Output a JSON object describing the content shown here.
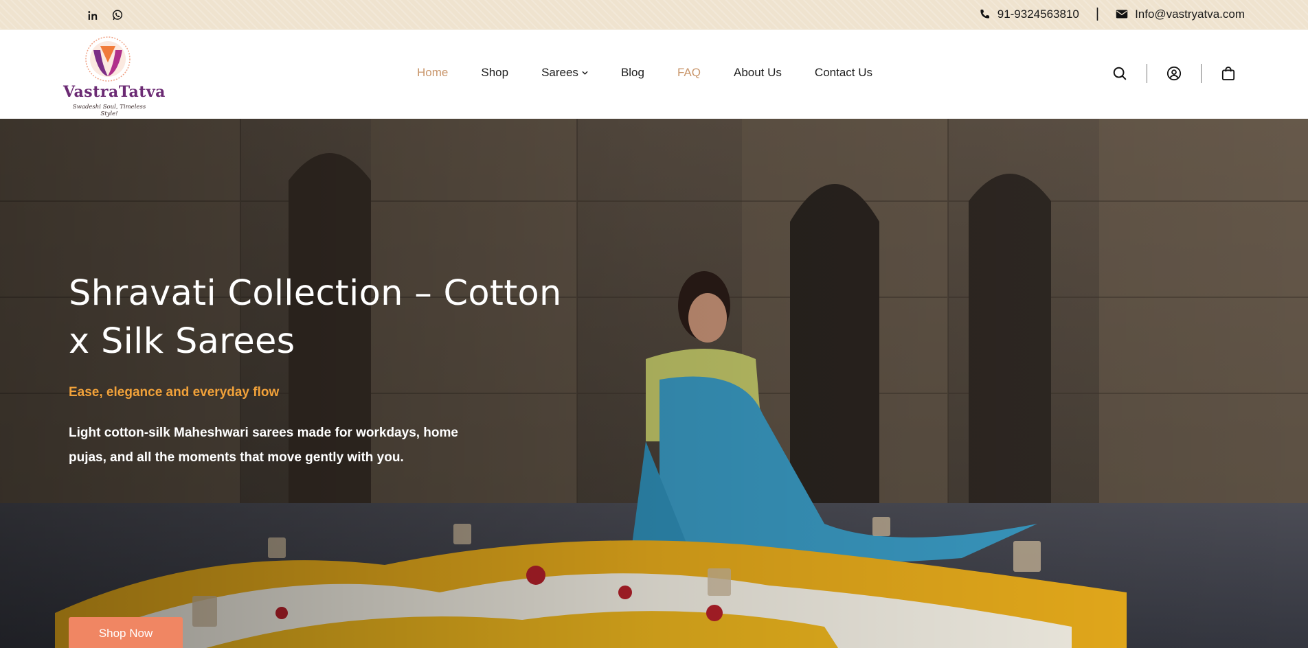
{
  "topbar": {
    "social": [
      {
        "icon": "linkedin-icon"
      },
      {
        "icon": "whatsapp-icon"
      }
    ],
    "phone": "91-9324563810",
    "separator": "|",
    "email": "Info@vastryatva.com"
  },
  "brand": {
    "name": "VastraTatva",
    "tagline": "Swadeshi Soul, Timeless Style!"
  },
  "nav": {
    "items": [
      {
        "label": "Home",
        "state": "active"
      },
      {
        "label": "Shop"
      },
      {
        "label": "Sarees",
        "has_dropdown": true
      },
      {
        "label": "Blog"
      },
      {
        "label": "FAQ"
      },
      {
        "label": "About Us"
      },
      {
        "label": "Contact Us"
      }
    ]
  },
  "header_icons": [
    "search-icon",
    "user-icon",
    "cart-icon"
  ],
  "hero": {
    "title": "Shravati Collection – Cotton x Silk Sarees",
    "subtitle": "Ease, elegance and everyday flow",
    "description": "Light cotton-silk Maheshwari sarees made for workdays, home pujas, and all the moments that move gently with you.",
    "cta": "Shop Now"
  },
  "colors": {
    "accent": "#c9966b",
    "cta": "#f08663",
    "subtitle": "#f2a23a",
    "topbar_bg": "#efe3cf"
  }
}
